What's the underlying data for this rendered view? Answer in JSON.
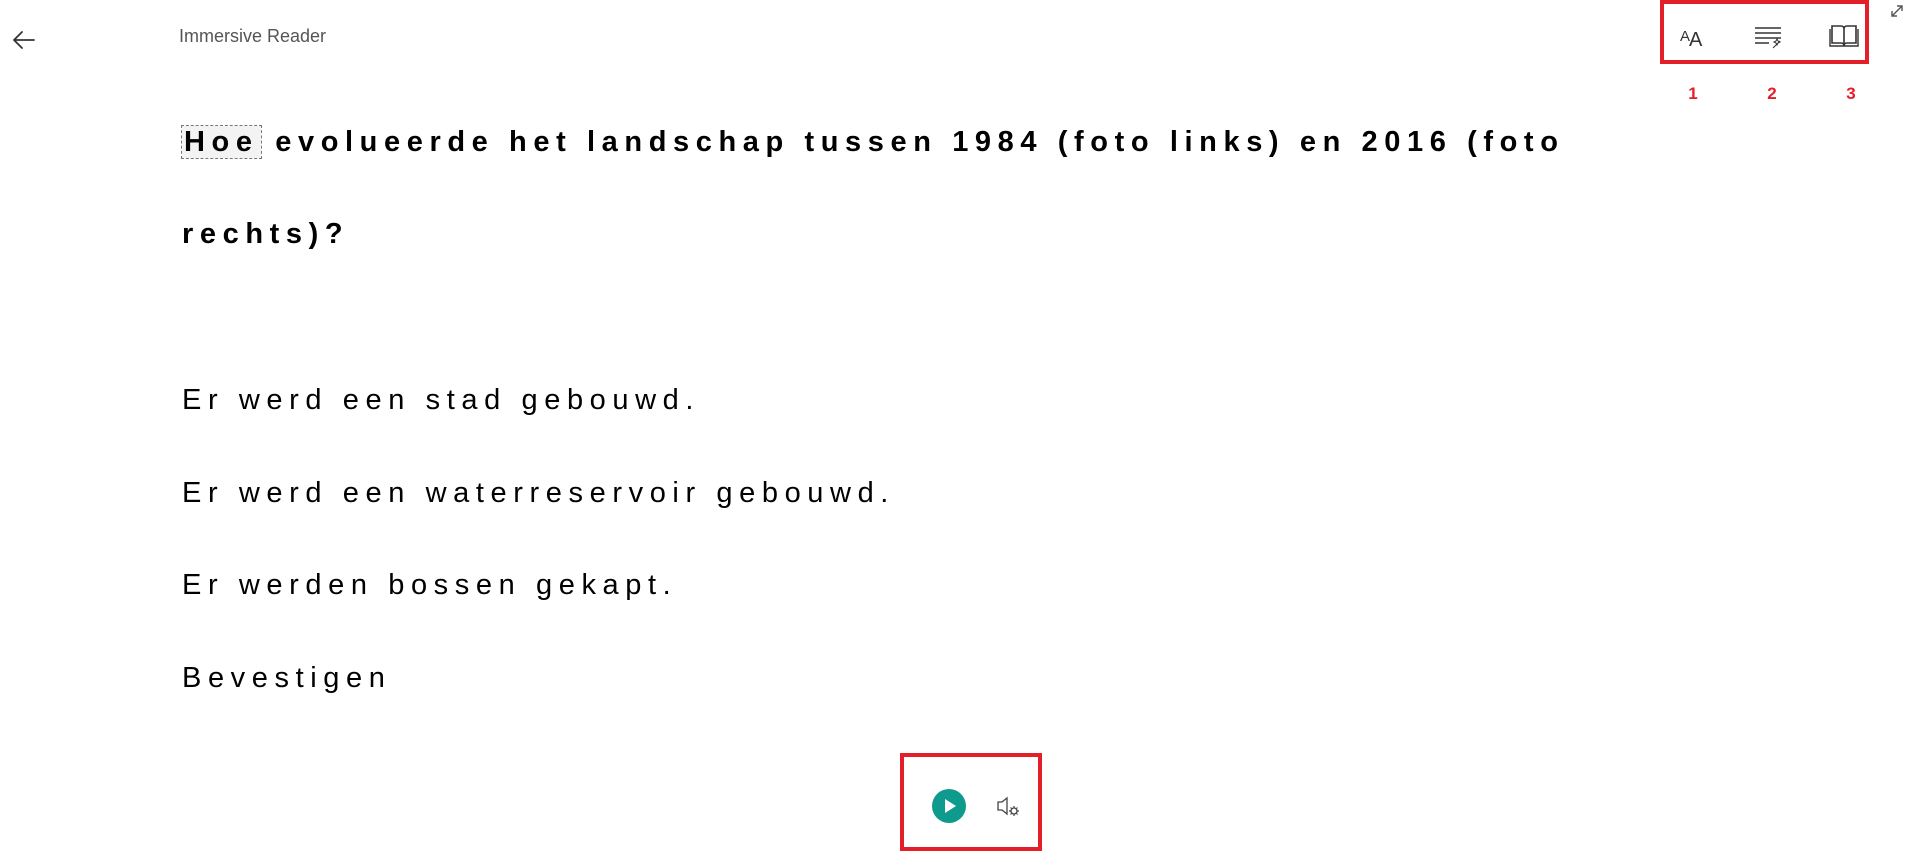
{
  "header": {
    "title": "Immersive Reader",
    "back_icon": "back-arrow-icon",
    "expand_icon": "expand-icon"
  },
  "toolbar": {
    "items": [
      {
        "icon": "text-preferences-icon",
        "number": "1"
      },
      {
        "icon": "grammar-options-icon",
        "number": "2"
      },
      {
        "icon": "reading-preferences-icon",
        "number": "3"
      }
    ],
    "highlight_color": "#e3202a"
  },
  "content": {
    "question_first_word": "Hoe",
    "question_rest": " evolueerde het landschap tussen 1984 (foto links) en 2016 (foto rechts)?",
    "options": [
      "Er werd een stad gebouwd.",
      "Er werd een waterreservoir gebouwd.",
      "Er werden bossen gekapt.",
      "Bevestigen"
    ]
  },
  "player": {
    "play_icon": "play-icon",
    "voice_settings_icon": "voice-settings-icon",
    "accent_color": "#0e9b8e"
  }
}
